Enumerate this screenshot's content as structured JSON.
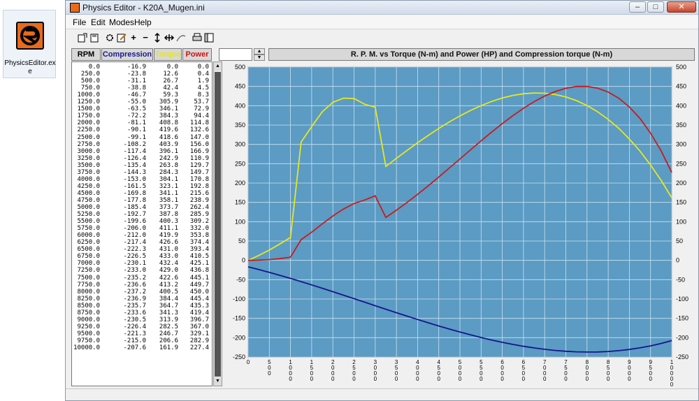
{
  "desktop": {
    "icon_label": "PhysicsEditor.exe",
    "icon_name": "physics-editor-app-icon"
  },
  "window": {
    "title": "Physics Editor - K20A_Mugen.ini",
    "controls": {
      "minimize": "–",
      "maximize": "□",
      "close": "✕"
    }
  },
  "menu": {
    "file": "File",
    "edit": "Edit",
    "modes": "Modes",
    "help": "Help"
  },
  "toolbar": {
    "icons": [
      "open-icon",
      "save-icon",
      "gear-icon",
      "edit-icon",
      "plus-icon",
      "minus-icon",
      "vertical-scale-icon",
      "horizontal-scale-icon",
      "curve-icon",
      "print-icon",
      "window-icon"
    ],
    "plus": "+",
    "minus": "−"
  },
  "table": {
    "headers": {
      "rpm": "RPM",
      "compression": "Compression",
      "torque": "Torque",
      "power": "Power"
    },
    "rows": [
      [
        "0.0",
        "-16.9",
        "0.0",
        "0.0"
      ],
      [
        "250.0",
        "-23.8",
        "12.6",
        "0.4"
      ],
      [
        "500.0",
        "-31.1",
        "26.7",
        "1.9"
      ],
      [
        "750.0",
        "-38.8",
        "42.4",
        "4.5"
      ],
      [
        "1000.0",
        "-46.7",
        "59.3",
        "8.3"
      ],
      [
        "1250.0",
        "-55.0",
        "305.9",
        "53.7"
      ],
      [
        "1500.0",
        "-63.5",
        "346.1",
        "72.9"
      ],
      [
        "1750.0",
        "-72.2",
        "384.3",
        "94.4"
      ],
      [
        "2000.0",
        "-81.1",
        "408.8",
        "114.8"
      ],
      [
        "2250.0",
        "-90.1",
        "419.6",
        "132.6"
      ],
      [
        "2500.0",
        "-99.1",
        "418.6",
        "147.0"
      ],
      [
        "2750.0",
        "-108.2",
        "403.9",
        "156.0"
      ],
      [
        "3000.0",
        "-117.4",
        "396.1",
        "166.9"
      ],
      [
        "3250.0",
        "-126.4",
        "242.9",
        "110.9"
      ],
      [
        "3500.0",
        "-135.4",
        "263.8",
        "129.7"
      ],
      [
        "3750.0",
        "-144.3",
        "284.3",
        "149.7"
      ],
      [
        "4000.0",
        "-153.0",
        "304.1",
        "170.8"
      ],
      [
        "4250.0",
        "-161.5",
        "323.1",
        "192.8"
      ],
      [
        "4500.0",
        "-169.8",
        "341.1",
        "215.6"
      ],
      [
        "4750.0",
        "-177.8",
        "358.1",
        "238.9"
      ],
      [
        "5000.0",
        "-185.4",
        "373.7",
        "262.4"
      ],
      [
        "5250.0",
        "-192.7",
        "387.8",
        "285.9"
      ],
      [
        "5500.0",
        "-199.6",
        "400.3",
        "309.2"
      ],
      [
        "5750.0",
        "-206.0",
        "411.1",
        "332.0"
      ],
      [
        "6000.0",
        "-212.0",
        "419.9",
        "353.8"
      ],
      [
        "6250.0",
        "-217.4",
        "426.6",
        "374.4"
      ],
      [
        "6500.0",
        "-222.3",
        "431.0",
        "393.4"
      ],
      [
        "6750.0",
        "-226.5",
        "433.0",
        "410.5"
      ],
      [
        "7000.0",
        "-230.1",
        "432.4",
        "425.1"
      ],
      [
        "7250.0",
        "-233.0",
        "429.0",
        "436.8"
      ],
      [
        "7500.0",
        "-235.2",
        "422.6",
        "445.1"
      ],
      [
        "7750.0",
        "-236.6",
        "413.2",
        "449.7"
      ],
      [
        "8000.0",
        "-237.2",
        "400.5",
        "450.0"
      ],
      [
        "8250.0",
        "-236.9",
        "384.4",
        "445.4"
      ],
      [
        "8500.0",
        "-235.7",
        "364.7",
        "435.3"
      ],
      [
        "8750.0",
        "-233.6",
        "341.3",
        "419.4"
      ],
      [
        "9000.0",
        "-230.5",
        "313.9",
        "396.7"
      ],
      [
        "9250.0",
        "-226.4",
        "282.5",
        "367.0"
      ],
      [
        "9500.0",
        "-221.3",
        "246.7",
        "329.1"
      ],
      [
        "9750.0",
        "-215.0",
        "206.6",
        "282.9"
      ],
      [
        "10000.0",
        "-207.6",
        "161.9",
        "227.4"
      ]
    ]
  },
  "chart_data": {
    "type": "line",
    "title": "R. P. M. vs Torque (N-m) and Power (HP) and Compression torque (N-m)",
    "xlabel": "",
    "ylabel": "",
    "xlim": [
      0,
      10000
    ],
    "ylim": [
      -250,
      500
    ],
    "x_ticks": [
      "0",
      "500",
      "1000",
      "1500",
      "2000",
      "2500",
      "3000",
      "3500",
      "4000",
      "4500",
      "5000",
      "5500",
      "6000",
      "6500",
      "7000",
      "7500",
      "8000",
      "8500",
      "9000",
      "9500",
      "10000"
    ],
    "y_ticks": [
      "500",
      "450",
      "400",
      "350",
      "300",
      "250",
      "200",
      "150",
      "100",
      "50",
      "0",
      "-50",
      "-100",
      "-150",
      "-200",
      "-250"
    ],
    "grid": true,
    "background": "#5b9bc4",
    "series": [
      {
        "key": "torque",
        "color": "#e8e81c"
      },
      {
        "key": "power",
        "color": "#c81c1c"
      },
      {
        "key": "compression",
        "color": "#16168a"
      }
    ]
  }
}
